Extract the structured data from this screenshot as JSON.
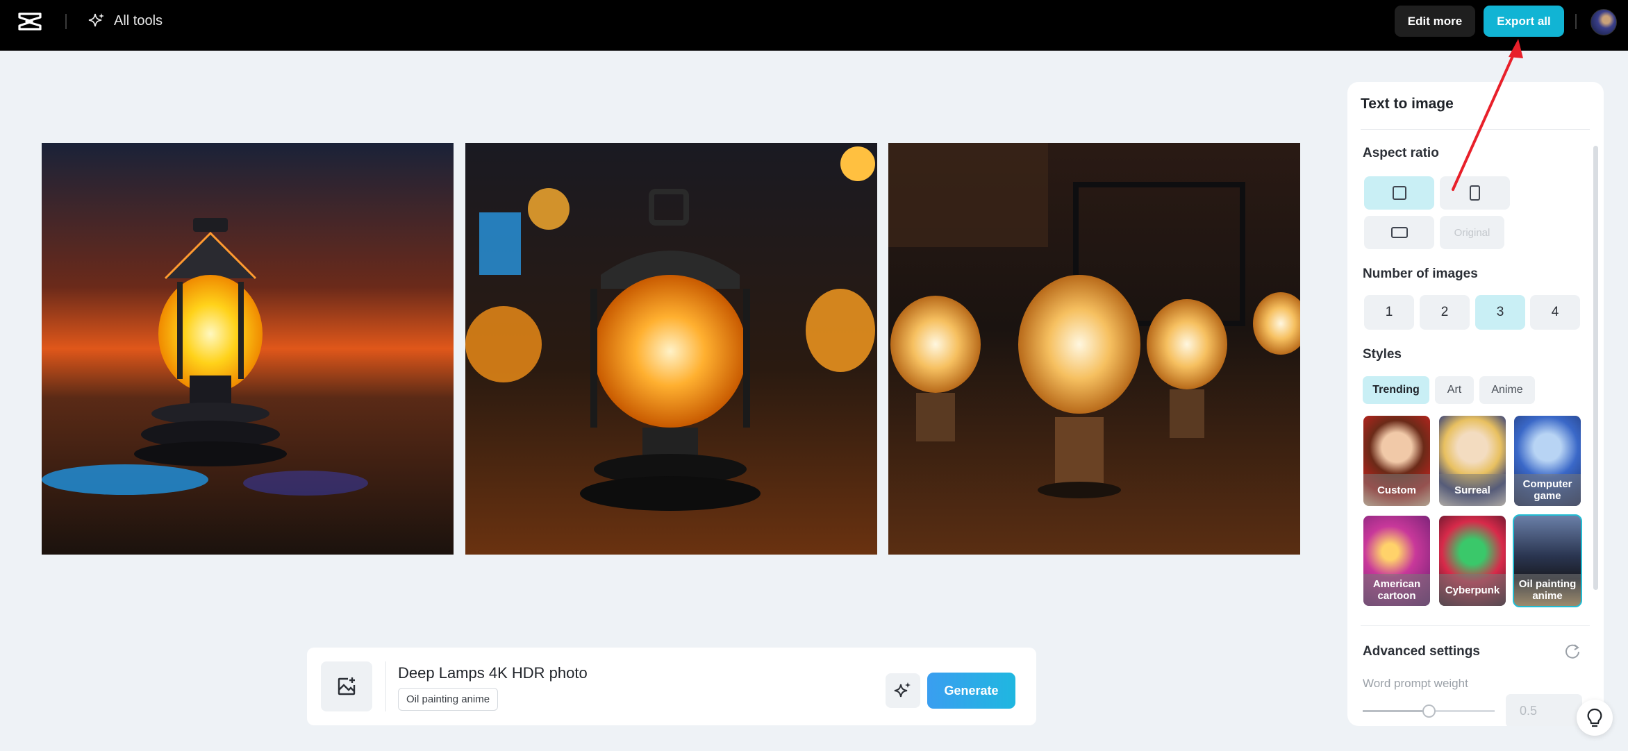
{
  "topbar": {
    "all_tools_label": "All tools",
    "edit_more_label": "Edit more",
    "export_all_label": "Export all"
  },
  "prompt": {
    "text": "Deep Lamps 4K HDR photo",
    "style_tag": "Oil painting anime",
    "generate_label": "Generate"
  },
  "panel": {
    "title": "Text to image",
    "aspect_ratio": {
      "label": "Aspect ratio",
      "options": [
        "square",
        "portrait",
        "landscape",
        "Original"
      ],
      "selected": "square"
    },
    "number_of_images": {
      "label": "Number of images",
      "options": [
        "1",
        "2",
        "3",
        "4"
      ],
      "selected": "3"
    },
    "styles": {
      "label": "Styles",
      "tabs": [
        "Trending",
        "Art",
        "Anime"
      ],
      "active_tab": "Trending",
      "tiles": [
        "Custom",
        "Surreal",
        "Computer game",
        "American cartoon",
        "Cyberpunk",
        "Oil painting anime"
      ],
      "selected_tile": "Oil painting anime"
    },
    "advanced": {
      "label": "Advanced settings",
      "word_prompt_weight_label": "Word prompt weight",
      "word_prompt_weight_value": "0.5",
      "slider_fraction": 0.5
    }
  },
  "colors": {
    "accent": "#11b4d4",
    "selected_bg": "#c9eff5",
    "annotation_arrow": "#e8202a"
  }
}
